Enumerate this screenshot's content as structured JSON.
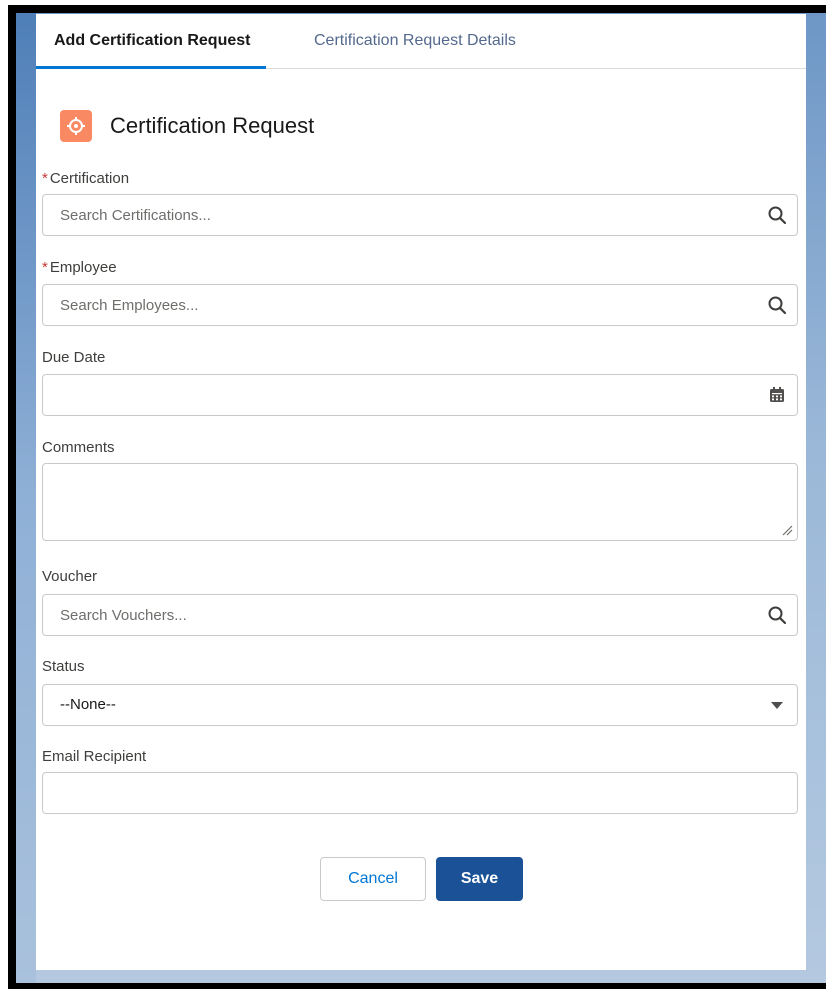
{
  "tabs": [
    {
      "label": "Add Certification Request",
      "active": true
    },
    {
      "label": "Certification Request Details",
      "active": false
    }
  ],
  "header": {
    "title": "Certification Request",
    "icon": "record-gear-icon",
    "icon_color": "#f88962"
  },
  "form": {
    "certification": {
      "label": "Certification",
      "required": "*",
      "placeholder": "Search Certifications...",
      "icon": "search-icon"
    },
    "employee": {
      "label": "Employee",
      "required": "*",
      "placeholder": "Search Employees...",
      "icon": "search-icon"
    },
    "due_date": {
      "label": "Due Date",
      "value": "",
      "icon": "calendar-icon"
    },
    "comments": {
      "label": "Comments",
      "value": ""
    },
    "voucher": {
      "label": "Voucher",
      "placeholder": "Search Vouchers...",
      "icon": "search-icon"
    },
    "status": {
      "label": "Status",
      "selected": "--None--",
      "icon": "caret-down-icon"
    },
    "email_recipient": {
      "label": "Email Recipient",
      "value": ""
    }
  },
  "actions": {
    "cancel_label": "Cancel",
    "save_label": "Save"
  },
  "colors": {
    "accent": "#0176d3",
    "brand_button": "#1b5297",
    "required": "#c23934"
  }
}
